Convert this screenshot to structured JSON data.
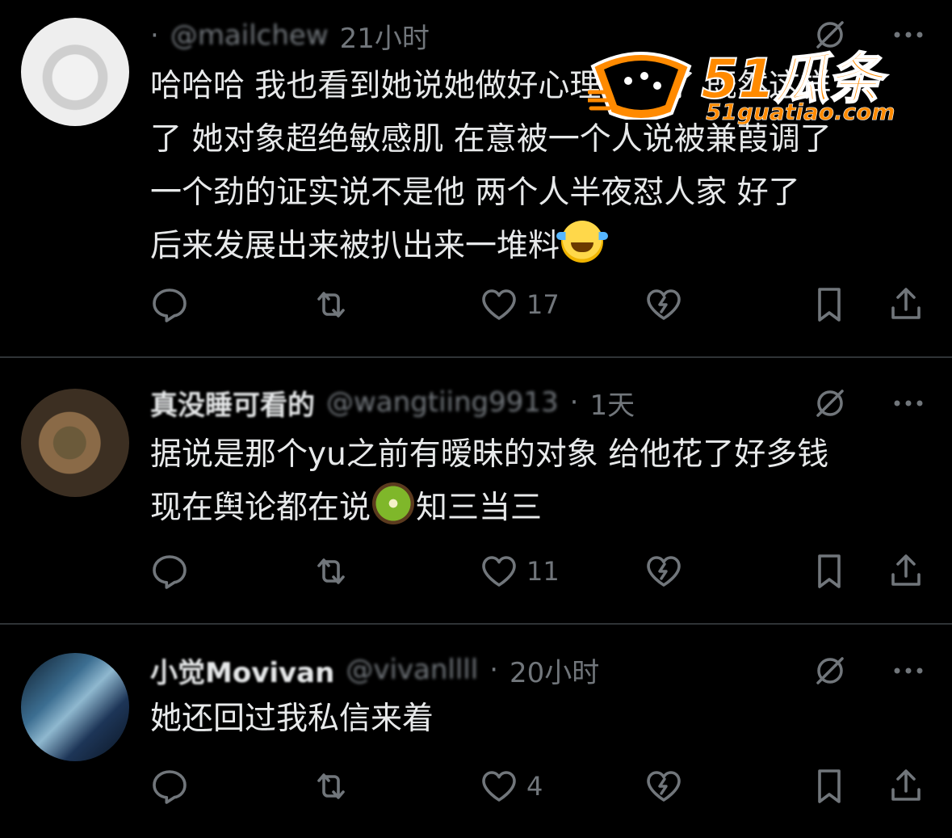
{
  "posts": [
    {
      "display_name": "",
      "handle": "@mailchew",
      "separator": "·",
      "time": "21小时",
      "body_lines": [
        "哈哈哈 我也看到她说她做好心理准备了 既然这样",
        "了 她对象超绝敏感肌 在意被一个人说被兼葭调了",
        "一个劲的证实说不是他 两个人半夜怼人家 好了",
        "后来发展出来被扒出来一堆料"
      ],
      "trailing_emoji": "joy-emoji",
      "likes": "17"
    },
    {
      "display_name": "真没睡可看的",
      "handle": "@wangtiing9913",
      "separator": "·",
      "time": "1天",
      "body_lines": [
        "据说是那个yu之前有暧昧的对象 给他花了好多钱",
        "现在舆论都在说",
        "知三当三"
      ],
      "trailing_emoji": "kiwi-emoji",
      "likes": "11"
    },
    {
      "display_name": "小觉Movivan",
      "handle": "@vivanllll",
      "separator": "·",
      "time": "20小时",
      "body_lines": [
        "她还回过我私信来着"
      ],
      "trailing_emoji": "",
      "likes": "4"
    }
  ],
  "watermark": {
    "title": "51瓜条",
    "url": "51guatiao.com"
  },
  "colors": {
    "background": "#000000",
    "text": "#e7e9ea",
    "muted": "#71767b",
    "divider": "#2f3336",
    "watermark": "#ff8a00"
  },
  "icons": [
    "reply-icon",
    "repost-icon",
    "like-icon",
    "dislike-icon",
    "bookmark-icon",
    "share-icon",
    "grok-icon",
    "more-icon"
  ]
}
